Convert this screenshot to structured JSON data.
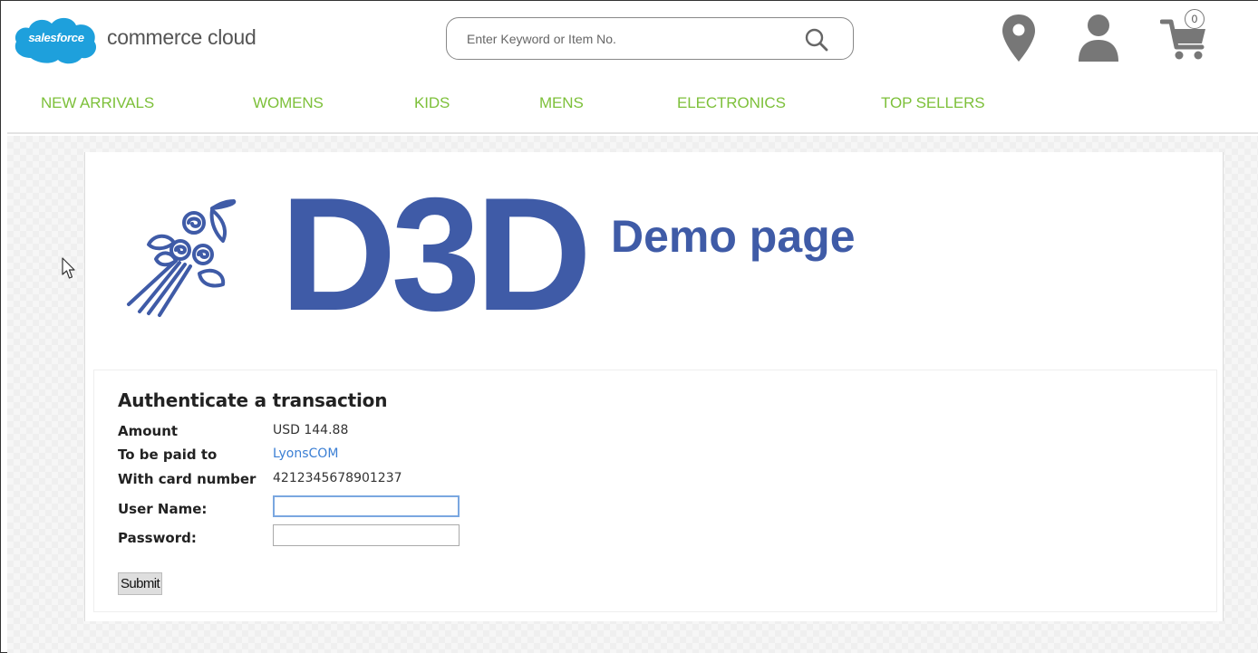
{
  "brand": {
    "cloud_text": "salesforce",
    "name": "commerce cloud",
    "cloud_color": "#1ea0dc"
  },
  "search": {
    "placeholder": "Enter Keyword or Item No.",
    "icon": "search-icon"
  },
  "header_icons": {
    "location": "location-pin-icon",
    "user": "user-icon",
    "cart": "cart-icon",
    "cart_count": "0"
  },
  "nav": {
    "color": "#7dc03a",
    "items": [
      {
        "label": "NEW ARRIVALS"
      },
      {
        "label": "WOMENS"
      },
      {
        "label": "KIDS"
      },
      {
        "label": "MENS"
      },
      {
        "label": "ELECTRONICS"
      },
      {
        "label": "TOP SELLERS"
      }
    ]
  },
  "banner": {
    "logo_text": "D3D",
    "subtitle": "Demo page",
    "color": "#3f5ba7",
    "image": "bouquet-icon"
  },
  "auth": {
    "title": "Authenticate a transaction",
    "amount_label": "Amount",
    "amount_value": "USD 144.88",
    "payee_label": "To be paid to",
    "payee_value": "LyonsCOM",
    "card_label": "With card number",
    "card_value": "4212345678901237",
    "username_label": "User Name:",
    "username_value": "",
    "password_label": "Password:",
    "password_value": "",
    "submit_label": "Submit",
    "link_color": "#3b7fd4"
  }
}
